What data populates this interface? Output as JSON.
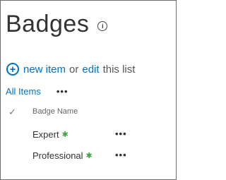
{
  "page": {
    "title": "Badges"
  },
  "icons": {
    "info": "info-icon",
    "add": "plus-circle-icon",
    "check": "checkmark-icon",
    "new": "new-item-icon",
    "more": "ellipsis-icon"
  },
  "actions": {
    "new_item": "new item",
    "or": "or",
    "edit": "edit",
    "this_list": "this list"
  },
  "views": {
    "current": "All Items",
    "more": "•••"
  },
  "list": {
    "columns": [
      "Badge Name"
    ],
    "rows": [
      {
        "name": "Expert",
        "more": "•••"
      },
      {
        "name": "Professional",
        "more": "•••"
      }
    ]
  },
  "colors": {
    "link": "#0072c6",
    "new_indicator": "#3fa33f"
  }
}
